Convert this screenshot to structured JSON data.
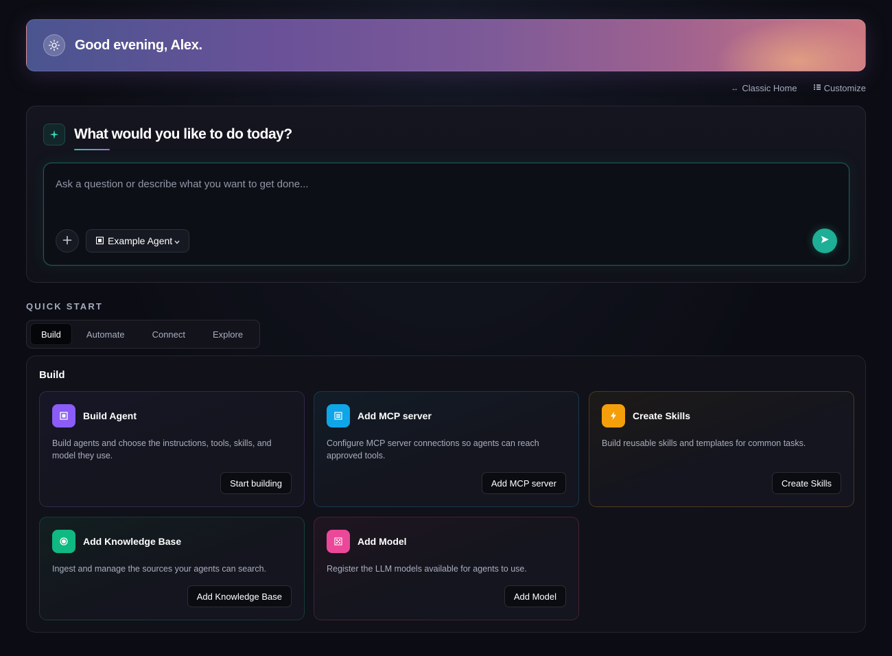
{
  "greeting": {
    "text": "Good evening, Alex.",
    "icon": "sun-icon"
  },
  "top_links": {
    "classic_home": {
      "label": "Classic Home",
      "icon": "arrows-horizontal-icon"
    },
    "customize": {
      "label": "Customize",
      "icon": "grid-icon"
    }
  },
  "prompt": {
    "title": "What would you like to do today?",
    "icon": "sparkle-icon",
    "placeholder": "Ask a question or describe what you want to get done...",
    "value": "",
    "agent_selector": {
      "label": "Example Agent",
      "icon": "agent-icon"
    },
    "add_icon": "plus-icon",
    "send_icon": "send-icon"
  },
  "quick_start": {
    "label": "QUICK START",
    "tabs": [
      {
        "label": "Build",
        "active": true
      },
      {
        "label": "Automate",
        "active": false
      },
      {
        "label": "Connect",
        "active": false
      },
      {
        "label": "Explore",
        "active": false
      }
    ],
    "panel_title": "Build",
    "cards": [
      {
        "title": "Build Agent",
        "description": "Build agents and choose the instructions, tools, skills, and model they use.",
        "button": "Start building",
        "icon": "agent-icon",
        "color": "#8b5cf6"
      },
      {
        "title": "Add MCP server",
        "description": "Configure MCP server connections so agents can reach approved tools.",
        "button": "Add MCP server",
        "icon": "server-icon",
        "color": "#0ea5e9"
      },
      {
        "title": "Create Skills",
        "description": "Build reusable skills and templates for common tasks.",
        "button": "Create Skills",
        "icon": "lightning-icon",
        "color": "#f59e0b"
      },
      {
        "title": "Add Knowledge Base",
        "description": "Ingest and manage the sources your agents can search.",
        "button": "Add Knowledge Base",
        "icon": "database-icon",
        "color": "#10b981"
      },
      {
        "title": "Add Model",
        "description": "Register the LLM models available for agents to use.",
        "button": "Add Model",
        "icon": "model-icon",
        "color": "#ec4899"
      }
    ]
  },
  "colors": {
    "accent": "#1fae96",
    "background": "#0c0d14"
  }
}
